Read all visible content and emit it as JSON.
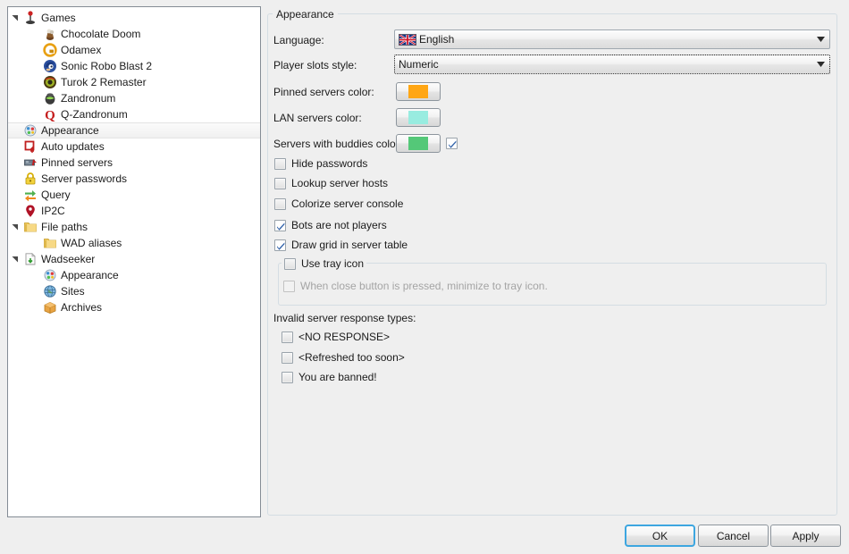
{
  "window": {
    "background_color": "#efefef",
    "type": "settings-dialog"
  },
  "sidebar": {
    "name": "configuration-tree",
    "items": [
      {
        "label": "Games",
        "icon": "joystick-icon",
        "indent": 0,
        "expandable": true,
        "expanded": true,
        "selected": false
      },
      {
        "label": "Chocolate Doom",
        "icon": "chocolate-doom-icon",
        "indent": 1,
        "expandable": false,
        "expanded": false,
        "selected": false
      },
      {
        "label": "Odamex",
        "icon": "odamex-icon",
        "indent": 1,
        "expandable": false,
        "expanded": false,
        "selected": false
      },
      {
        "label": "Sonic Robo Blast 2",
        "icon": "sonic-icon",
        "indent": 1,
        "expandable": false,
        "expanded": false,
        "selected": false
      },
      {
        "label": "Turok 2 Remaster",
        "icon": "turok2-icon",
        "indent": 1,
        "expandable": false,
        "expanded": false,
        "selected": false
      },
      {
        "label": "Zandronum",
        "icon": "zandronum-icon",
        "indent": 1,
        "expandable": false,
        "expanded": false,
        "selected": false
      },
      {
        "label": "Q-Zandronum",
        "icon": "q-zandronum-icon",
        "indent": 1,
        "expandable": false,
        "expanded": false,
        "selected": false
      },
      {
        "label": "Appearance",
        "icon": "appearance-icon",
        "indent": 0,
        "expandable": false,
        "expanded": false,
        "selected": true
      },
      {
        "label": "Auto updates",
        "icon": "auto-updates-icon",
        "indent": 0,
        "expandable": false,
        "expanded": false,
        "selected": false
      },
      {
        "label": "Pinned servers",
        "icon": "pinned-servers-icon",
        "indent": 0,
        "expandable": false,
        "expanded": false,
        "selected": false
      },
      {
        "label": "Server passwords",
        "icon": "padlock-icon",
        "indent": 0,
        "expandable": false,
        "expanded": false,
        "selected": false
      },
      {
        "label": "Query",
        "icon": "refresh-arrows-icon",
        "indent": 0,
        "expandable": false,
        "expanded": false,
        "selected": false
      },
      {
        "label": "IP2C",
        "icon": "map-pin-icon",
        "indent": 0,
        "expandable": false,
        "expanded": false,
        "selected": false
      },
      {
        "label": "File paths",
        "icon": "folder-icon",
        "indent": 0,
        "expandable": true,
        "expanded": true,
        "selected": false
      },
      {
        "label": "WAD aliases",
        "icon": "folder-icon",
        "indent": 1,
        "expandable": false,
        "expanded": false,
        "selected": false
      },
      {
        "label": "Wadseeker",
        "icon": "wadseeker-icon",
        "indent": 0,
        "expandable": true,
        "expanded": true,
        "selected": false
      },
      {
        "label": "Appearance",
        "icon": "appearance-icon",
        "indent": 1,
        "expandable": false,
        "expanded": false,
        "selected": false
      },
      {
        "label": "Sites",
        "icon": "globe-icon",
        "indent": 1,
        "expandable": false,
        "expanded": false,
        "selected": false
      },
      {
        "label": "Archives",
        "icon": "archive-box-icon",
        "indent": 1,
        "expandable": false,
        "expanded": false,
        "selected": false
      }
    ]
  },
  "main": {
    "group_title": "Appearance",
    "language": {
      "label": "Language:",
      "value": "English",
      "flag": "union-jack-flag-icon"
    },
    "player_slots_style": {
      "label": "Player slots style:",
      "value": "Numeric",
      "focused": true
    },
    "colors": [
      {
        "label": "Pinned servers color:",
        "color": "#ffa614",
        "has_toggle": false,
        "toggle_checked": false
      },
      {
        "label": "LAN servers color:",
        "color": "#98ece0",
        "has_toggle": false,
        "toggle_checked": false
      },
      {
        "label": "Servers with buddies color:",
        "color": "#54c878",
        "has_toggle": true,
        "toggle_checked": true
      }
    ],
    "options": [
      {
        "label": "Hide passwords",
        "checked": false,
        "enabled": true
      },
      {
        "label": "Lookup server hosts",
        "checked": false,
        "enabled": true
      },
      {
        "label": "Colorize server console",
        "checked": false,
        "enabled": true
      },
      {
        "label": "Bots are not players",
        "checked": true,
        "enabled": true
      },
      {
        "label": "Draw grid in server table",
        "checked": true,
        "enabled": true
      }
    ],
    "tray": {
      "group_label": "Use tray icon",
      "group_checked": false,
      "child_label": "When close button is pressed, minimize to tray icon.",
      "child_checked": false,
      "child_enabled": false
    },
    "invalid_responses": {
      "label": "Invalid server response types:",
      "items": [
        {
          "label": "<NO RESPONSE>",
          "checked": false
        },
        {
          "label": "<Refreshed too soon>",
          "checked": false
        },
        {
          "label": "You are banned!",
          "checked": false
        }
      ]
    }
  },
  "footer": {
    "ok_label": "OK",
    "cancel_label": "Cancel",
    "apply_label": "Apply",
    "default_button": "OK",
    "focus_accent_color": "#3da6e0"
  }
}
